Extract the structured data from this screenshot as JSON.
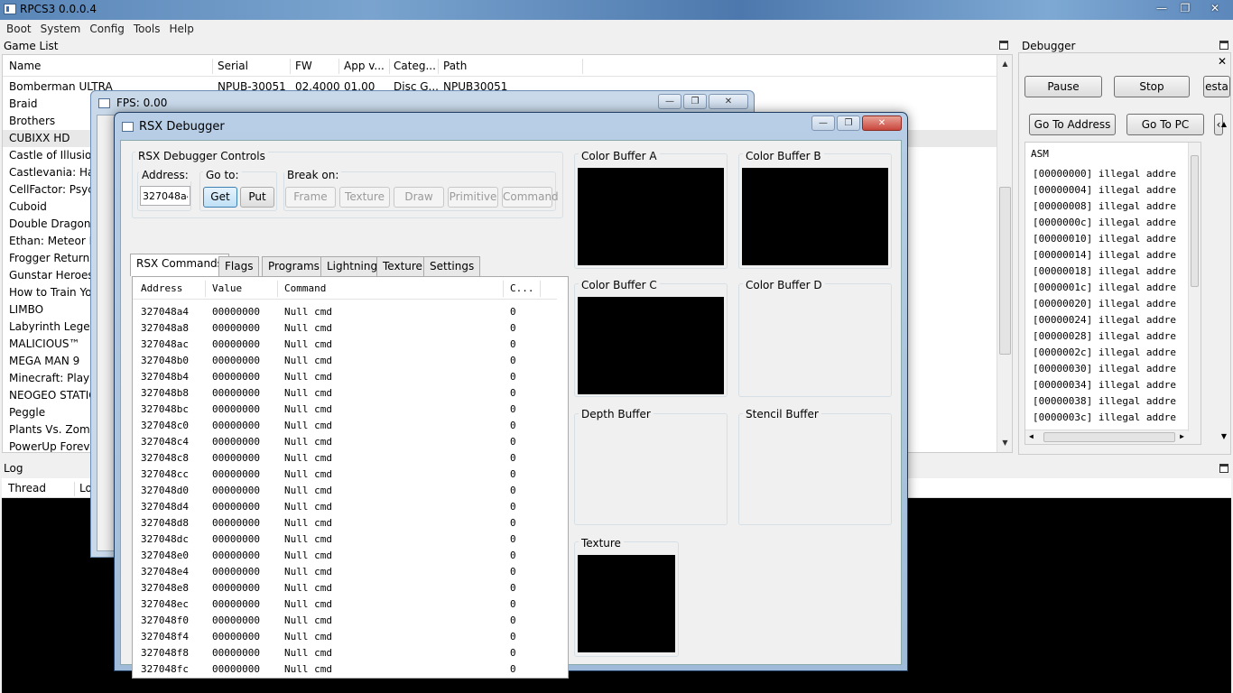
{
  "main_window": {
    "title": "RPCS3 0.0.0.4"
  },
  "menu": [
    "Boot",
    "System",
    "Config",
    "Tools",
    "Help"
  ],
  "game_list": {
    "title": "Game List",
    "columns": [
      "Name",
      "Serial",
      "FW",
      "App v...",
      "Categ...",
      "Path"
    ],
    "rows": [
      {
        "name": "Bomberman ULTRA",
        "serial": "NPUB-30051",
        "fw": "02.4000",
        "app": "01.00",
        "cat": "Disc G...",
        "path": "NPUB30051"
      },
      {
        "name": "Braid"
      },
      {
        "name": "Brothers"
      },
      {
        "name": "CUBIXX HD"
      },
      {
        "name": "Castle of Illusion"
      },
      {
        "name": "Castlevania: Harm"
      },
      {
        "name": "CellFactor: Psych"
      },
      {
        "name": "Cuboid"
      },
      {
        "name": "Double Dragon N"
      },
      {
        "name": "Ethan: Meteor Hu"
      },
      {
        "name": "Frogger Returns"
      },
      {
        "name": "Gunstar Heroes"
      },
      {
        "name": "How to Train You"
      },
      {
        "name": "LIMBO"
      },
      {
        "name": "Labyrinth Legend"
      },
      {
        "name": "MALICIOUS™"
      },
      {
        "name": "MEGA MAN 9"
      },
      {
        "name": "Minecraft: PlaySt"
      },
      {
        "name": "NEOGEO STATIO"
      },
      {
        "name": "Peggle"
      },
      {
        "name": "Plants Vs. Zombie"
      },
      {
        "name": "PowerUp Forever"
      }
    ]
  },
  "debugger": {
    "title": "Debugger",
    "pause": "Pause",
    "stop": "Stop",
    "restart_partial": "esta",
    "go_to_address": "Go To Address",
    "go_to_pc": "Go To PC",
    "asm_header": "ASM",
    "asm_lines": [
      "[00000000] illegal addre",
      "[00000004] illegal addre",
      "[00000008] illegal addre",
      "[0000000c] illegal addre",
      "[00000010] illegal addre",
      "[00000014] illegal addre",
      "[00000018] illegal addre",
      "[0000001c] illegal addre",
      "[00000020] illegal addre",
      "[00000024] illegal addre",
      "[00000028] illegal addre",
      "[0000002c] illegal addre",
      "[00000030] illegal addre",
      "[00000034] illegal addre",
      "[00000038] illegal addre",
      "[0000003c] illegal addre"
    ]
  },
  "log": {
    "title": "Log",
    "col_thread": "Thread",
    "col_log_partial": "Lo"
  },
  "fps_window": {
    "title": "FPS: 0.00"
  },
  "rsx": {
    "title": "RSX Debugger",
    "controls_title": "RSX Debugger Controls",
    "address_label": "Address:",
    "address_value": "327048a4",
    "goto_label": "Go to:",
    "get": "Get",
    "put": "Put",
    "break_label": "Break on:",
    "break_buttons": [
      "Frame",
      "Texture",
      "Draw",
      "Primitive",
      "Command"
    ],
    "tabs": [
      "RSX Commands",
      "Flags",
      "Programs",
      "Lightning",
      "Texture",
      "Settings"
    ],
    "table_headers": [
      "Address",
      "Value",
      "Command",
      "C..."
    ],
    "commands": [
      {
        "addr": "327048a4",
        "value": "00000000",
        "cmd": "Null cmd",
        "count": "0"
      },
      {
        "addr": "327048a8",
        "value": "00000000",
        "cmd": "Null cmd",
        "count": "0"
      },
      {
        "addr": "327048ac",
        "value": "00000000",
        "cmd": "Null cmd",
        "count": "0"
      },
      {
        "addr": "327048b0",
        "value": "00000000",
        "cmd": "Null cmd",
        "count": "0"
      },
      {
        "addr": "327048b4",
        "value": "00000000",
        "cmd": "Null cmd",
        "count": "0"
      },
      {
        "addr": "327048b8",
        "value": "00000000",
        "cmd": "Null cmd",
        "count": "0"
      },
      {
        "addr": "327048bc",
        "value": "00000000",
        "cmd": "Null cmd",
        "count": "0"
      },
      {
        "addr": "327048c0",
        "value": "00000000",
        "cmd": "Null cmd",
        "count": "0"
      },
      {
        "addr": "327048c4",
        "value": "00000000",
        "cmd": "Null cmd",
        "count": "0"
      },
      {
        "addr": "327048c8",
        "value": "00000000",
        "cmd": "Null cmd",
        "count": "0"
      },
      {
        "addr": "327048cc",
        "value": "00000000",
        "cmd": "Null cmd",
        "count": "0"
      },
      {
        "addr": "327048d0",
        "value": "00000000",
        "cmd": "Null cmd",
        "count": "0"
      },
      {
        "addr": "327048d4",
        "value": "00000000",
        "cmd": "Null cmd",
        "count": "0"
      },
      {
        "addr": "327048d8",
        "value": "00000000",
        "cmd": "Null cmd",
        "count": "0"
      },
      {
        "addr": "327048dc",
        "value": "00000000",
        "cmd": "Null cmd",
        "count": "0"
      },
      {
        "addr": "327048e0",
        "value": "00000000",
        "cmd": "Null cmd",
        "count": "0"
      },
      {
        "addr": "327048e4",
        "value": "00000000",
        "cmd": "Null cmd",
        "count": "0"
      },
      {
        "addr": "327048e8",
        "value": "00000000",
        "cmd": "Null cmd",
        "count": "0"
      },
      {
        "addr": "327048ec",
        "value": "00000000",
        "cmd": "Null cmd",
        "count": "0"
      },
      {
        "addr": "327048f0",
        "value": "00000000",
        "cmd": "Null cmd",
        "count": "0"
      },
      {
        "addr": "327048f4",
        "value": "00000000",
        "cmd": "Null cmd",
        "count": "0"
      },
      {
        "addr": "327048f8",
        "value": "00000000",
        "cmd": "Null cmd",
        "count": "0"
      },
      {
        "addr": "327048fc",
        "value": "00000000",
        "cmd": "Null cmd",
        "count": "0"
      }
    ],
    "buffers": {
      "a": "Color Buffer A",
      "b": "Color Buffer B",
      "c": "Color Buffer C",
      "d": "Color Buffer D",
      "depth": "Depth Buffer",
      "stencil": "Stencil Buffer",
      "texture": "Texture"
    }
  },
  "icons": {
    "minimize": "minimize-icon",
    "maximize": "maximize-icon",
    "close": "close-icon",
    "float": "dock-float-icon"
  },
  "colors": {
    "titlebar": "#5a86b8",
    "focus_accent": "#3c7fb1",
    "close_button": "#c9463d"
  }
}
